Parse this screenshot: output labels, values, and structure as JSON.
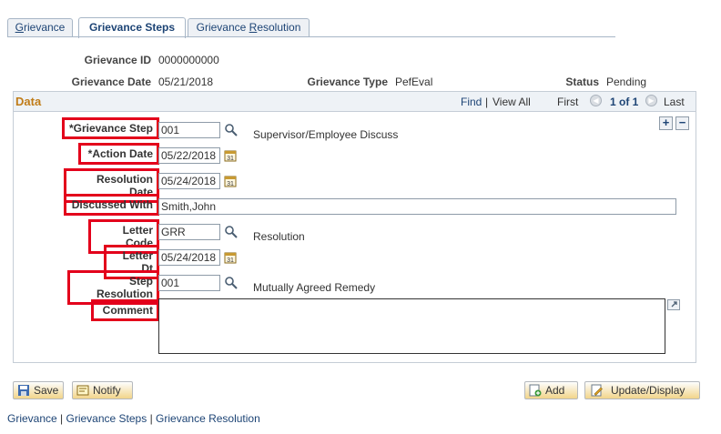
{
  "tabs": [
    {
      "label_prefix": "",
      "label_ul": "G",
      "label_rest": "rievance"
    },
    {
      "label": "Grievance Steps"
    },
    {
      "label_prefix": "Grievance ",
      "label_ul": "R",
      "label_rest": "esolution"
    }
  ],
  "header": {
    "grievance_id_label": "Grievance ID",
    "grievance_id_value": "0000000000",
    "grievance_date_label": "Grievance Date",
    "grievance_date_value": "05/21/2018",
    "grievance_type_label": "Grievance Type",
    "grievance_type_value": "PefEval",
    "status_label": "Status",
    "status_value": "Pending"
  },
  "data": {
    "title": "Data",
    "find": "Find",
    "sep": "|",
    "view_all": "View All",
    "first": "First",
    "range": "1 of 1",
    "last": "Last",
    "add_row": "+",
    "delete_row": "−"
  },
  "form": {
    "grievance_step_label": "*Grievance Step",
    "grievance_step_value": "001",
    "grievance_step_desc": "Supervisor/Employee Discuss",
    "action_date_label": "*Action Date",
    "action_date_value": "05/22/2018",
    "resolution_date_label": "Resolution Date",
    "resolution_date_value": "05/24/2018",
    "discussed_with_label": "Discussed With",
    "discussed_with_value": "Smith,John",
    "letter_code_label": "Letter Code",
    "letter_code_value": "GRR",
    "letter_code_desc": "Resolution",
    "letter_dt_label": "Letter Dt",
    "letter_dt_value": "05/24/2018",
    "step_resolution_label": "Step Resolution",
    "step_resolution_value": "001",
    "step_resolution_desc": "Mutually Agreed Remedy",
    "comment_label": "Comment",
    "comment_value": ""
  },
  "buttons": {
    "save": "Save",
    "notify": "Notify",
    "add": "Add",
    "update_display": "Update/Display"
  },
  "footer": {
    "link1": "Grievance",
    "sep": "|",
    "link2": "Grievance Steps",
    "link3": "Grievance Resolution"
  },
  "colors": {
    "highlight": "#e3001b",
    "link": "#1d4475",
    "section_title": "#c07c18"
  }
}
